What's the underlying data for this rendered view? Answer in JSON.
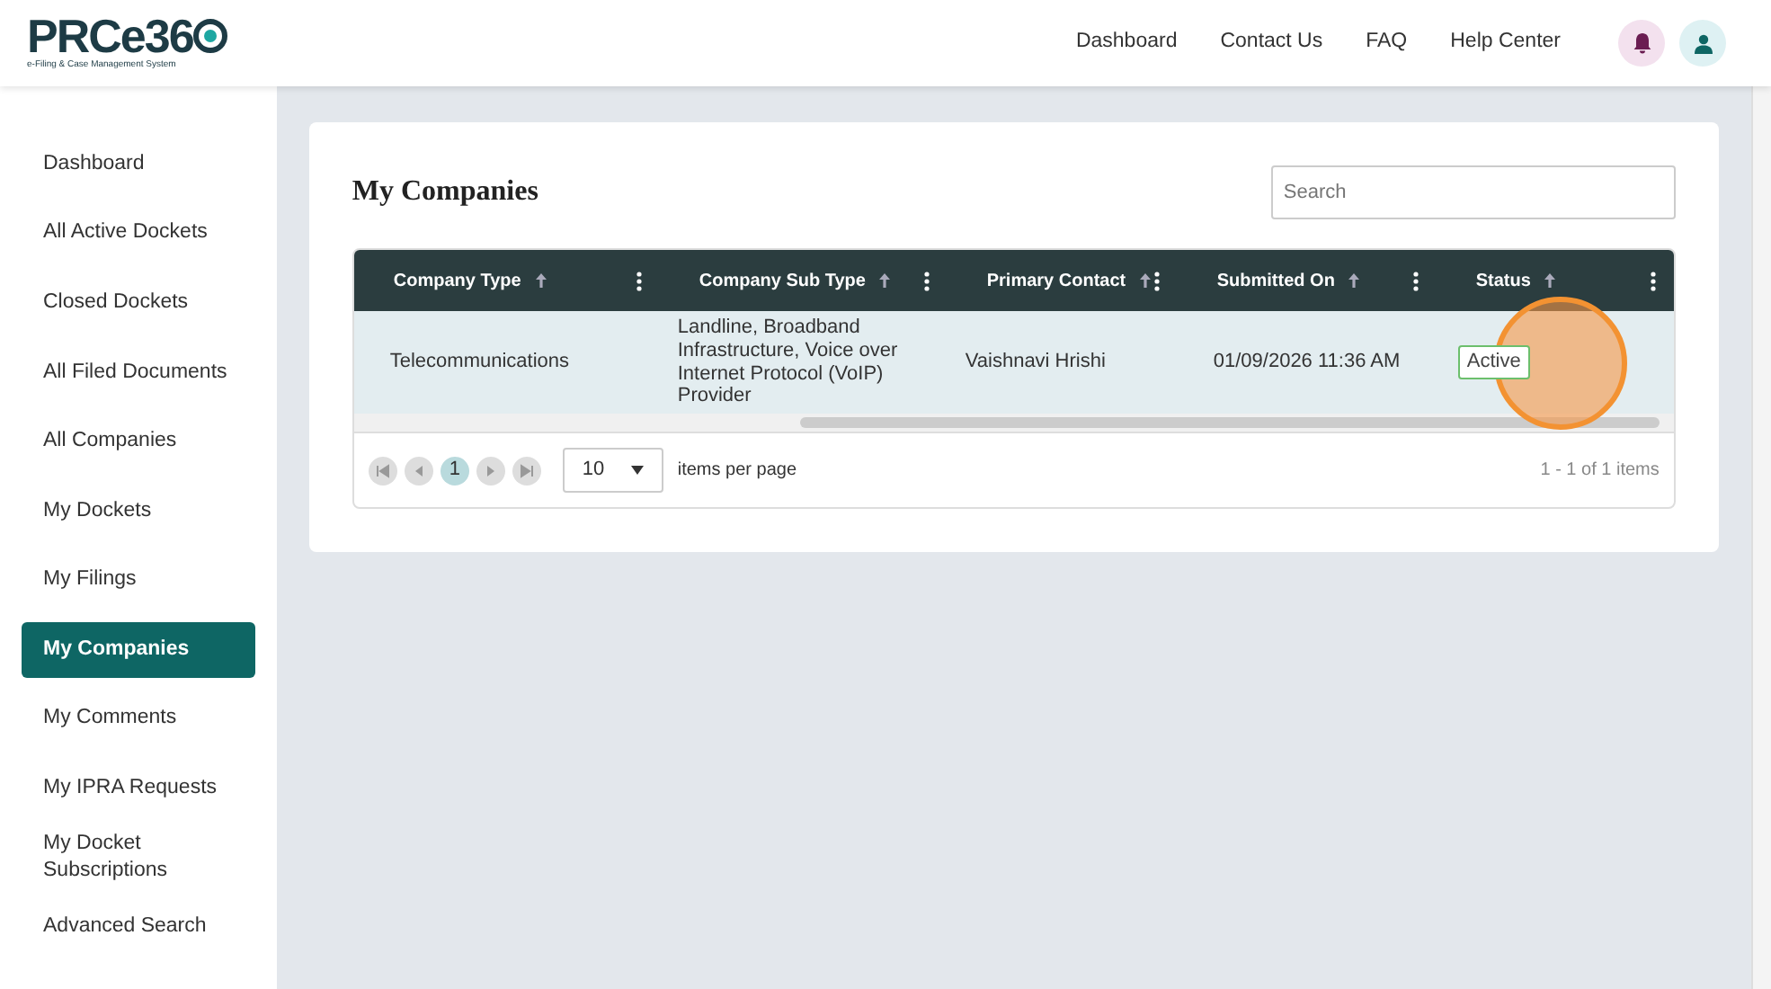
{
  "logo": {
    "text": "PRCe36",
    "tagline": "e-Filing & Case Management System"
  },
  "top_nav": [
    "Dashboard",
    "Contact Us",
    "FAQ",
    "Help Center"
  ],
  "sidebar": {
    "items": [
      {
        "label": "Dashboard",
        "selected": false
      },
      {
        "label": "All Active Dockets",
        "selected": false
      },
      {
        "label": "Closed Dockets",
        "selected": false
      },
      {
        "label": "All Filed Documents",
        "selected": false
      },
      {
        "label": "All Companies",
        "selected": false
      },
      {
        "label": "My Dockets",
        "selected": false
      },
      {
        "label": "My Filings",
        "selected": false
      },
      {
        "label": "My Companies",
        "selected": true
      },
      {
        "label": "My Comments",
        "selected": false
      },
      {
        "label": "My IPRA Requests",
        "selected": false
      },
      {
        "label": "My Docket Subscriptions",
        "selected": false
      },
      {
        "label": "Advanced Search",
        "selected": false
      }
    ]
  },
  "panel": {
    "title": "My Companies",
    "search": {
      "placeholder": "Search"
    },
    "table": {
      "columns": [
        "Company Type",
        "Company Sub Type",
        "Primary Contact",
        "Submitted On",
        "Status"
      ],
      "rows": [
        {
          "cells": [
            "Telecommunications",
            "Landline, Broadband Infrastructure, Voice over Internet Protocol (VoIP) Provider",
            "Vaishnavi Hrishi",
            "01/09/2026 11:36 AM"
          ],
          "status": "Active"
        }
      ]
    },
    "pager": {
      "pages": [
        {
          "label": "1",
          "selected": true
        }
      ],
      "page_size": "10",
      "page_size_label": "items per page",
      "summary": "1 - 1 of 1 items"
    }
  }
}
